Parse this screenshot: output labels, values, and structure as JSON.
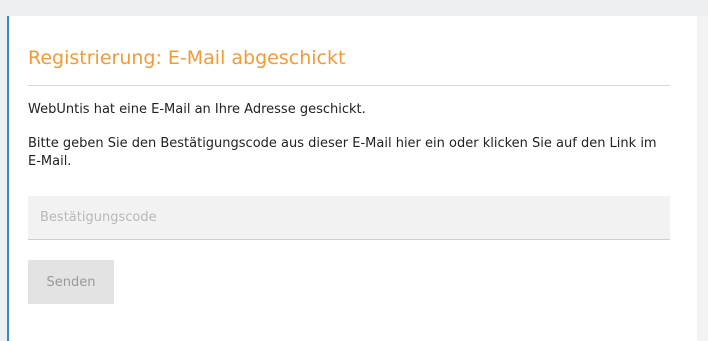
{
  "title": "Registrierung: E-Mail abgeschickt",
  "message": "WebUntis hat eine E-Mail an Ihre Adresse geschickt.",
  "instruction": "Bitte geben Sie den Bestätigungscode aus dieser E-Mail hier ein oder klicken Sie auf den Link im E-Mail.",
  "code_input": {
    "placeholder": "Bestätigungscode",
    "value": ""
  },
  "send_button": {
    "label": "Senden"
  },
  "colors": {
    "title": "#f39a35",
    "accent_border": "#3a86c8",
    "input_background": "#f2f2f2",
    "button_background": "#e3e3e3"
  }
}
